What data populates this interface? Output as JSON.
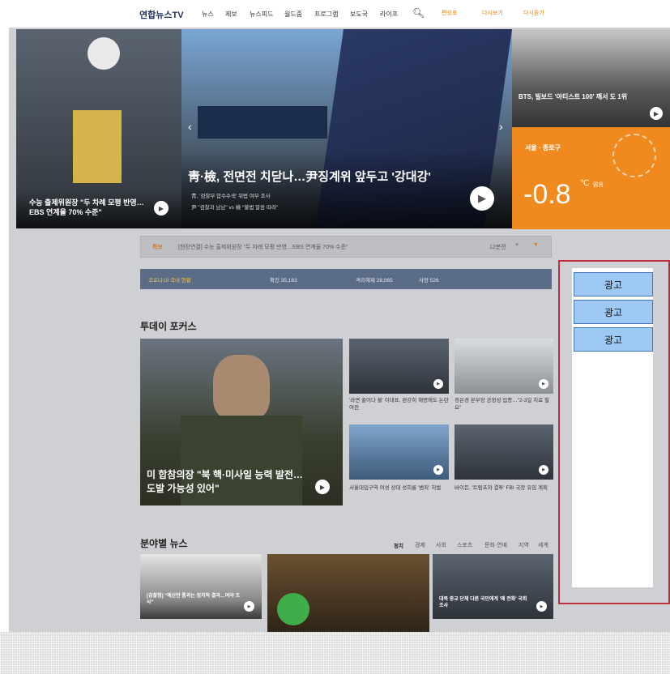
{
  "nav": {
    "logo": "연합뉴스TV",
    "items": [
      "뉴스",
      "제보",
      "뉴스피드",
      "월드줌",
      "프로그램",
      "보도국",
      "라이프"
    ],
    "extras": [
      "편성표",
      "다시보기",
      "다시듣기"
    ]
  },
  "hero": {
    "left_caption": "수능 출제위원장 \"두 차례 모평 반영…EBS 연계율 70% 수준\"",
    "center_title": "靑·檢, 전면전 치닫나…尹징계위 앞두고 '강대강'",
    "center_sub": [
      "靑, '검찰부 압수수색' 위법 여부 조사",
      "尹 \"검찰과 남남\" vs 檢 \"불법 말씀 따라\""
    ],
    "right_caption": "BTS, 빌보드 '아티스트 100' 깨서 도 1위"
  },
  "weather": {
    "location": "서울 · 종로구",
    "temperature": "-0.8",
    "unit": "℃",
    "condition": "맑음"
  },
  "ticker": {
    "badge": "특보",
    "text": "[현장연결] 수능 출제위원장 \"두 차례 모평 반영…EBS 연계율 70% 수준\"",
    "time": "12분전"
  },
  "covid": {
    "label": "코로나19 국내 현황",
    "confirmed": "확진 35,163",
    "quarantine": "격리해제 28,065",
    "deaths": "사망 526"
  },
  "focus": {
    "title": "투데이 포커스",
    "main_caption": "미 합참의장 \"북 핵·미사일 능력 발전…도발 가능성 있어\"",
    "items": [
      "'라면 끓이다 불' 이대표, 완강히 해명에도 논란 여전",
      "정은경 본부장 공정성 입증…\"2-3일 치료 필요\"",
      "서울대입구역 여성 상대 성희롱 '범죄' 처벌",
      "바이든, '트럼프와 결투' FBI 국장 유임 계획"
    ]
  },
  "category": {
    "title": "분야별 뉴스",
    "tabs": [
      "정치",
      "경제",
      "사회",
      "스포츠",
      "문화·연예",
      "지역",
      "세계"
    ],
    "items": [
      "[검찰청] \"예산안 통과는 정치적 결과…여야 조사\"",
      "대북 종교 단체 다른 국민에게 '왜 전화' 국회 조사"
    ]
  },
  "ads": {
    "labels": [
      "광고",
      "광고",
      "광고"
    ]
  },
  "colors": {
    "ad_button_bg": "#9ec9f5",
    "ad_box_border": "#c0303a",
    "weather_bg": "#f08a1e"
  }
}
